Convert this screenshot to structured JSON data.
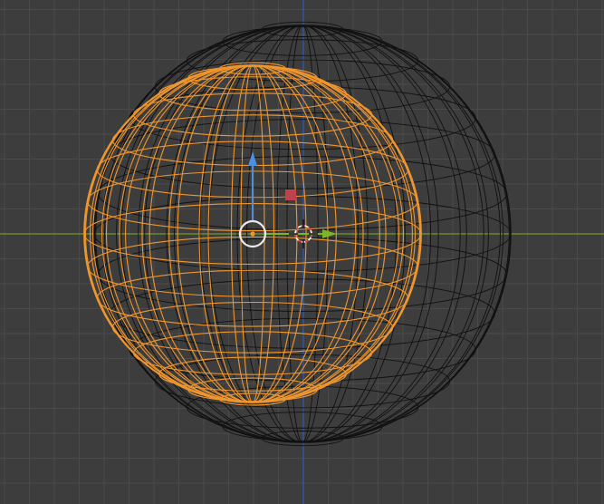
{
  "viewport": {
    "background_color": "#3d3d3d",
    "grid_color": "#4a4a4a",
    "x_axis_color": "#6f9a2a",
    "z_axis_color": "#2f5bb8"
  },
  "objects": {
    "selected_sphere": {
      "role": "active object",
      "wire_color": "#f0962e",
      "display": "wireframe"
    },
    "background_sphere": {
      "role": "unselected object",
      "wire_color": "#111111",
      "display": "wireframe"
    }
  },
  "gizmo": {
    "z_arrow_color": "#4f8fe0",
    "x_arrow_color": "#7ab728",
    "plane_handle_color": "#c0424f",
    "pivot_ring_color": "#e8e8e8",
    "origin_dot_color": "#f0962e"
  },
  "cursor_3d": {
    "ring_color_a": "#e23a3a",
    "ring_color_b": "#ffffff",
    "crosshair_color": "#111111"
  }
}
